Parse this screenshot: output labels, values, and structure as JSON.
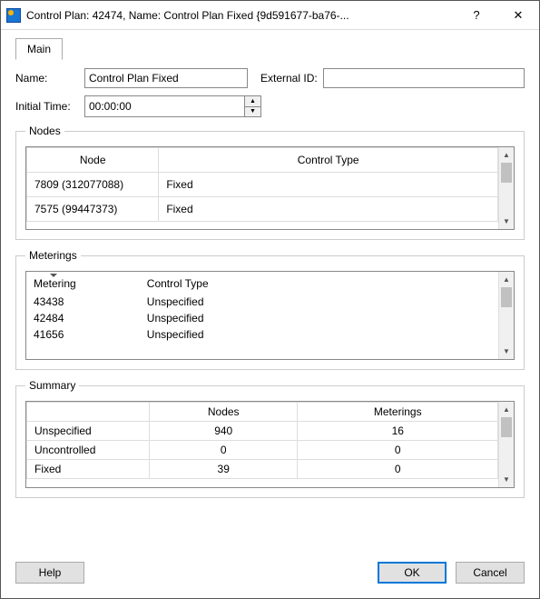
{
  "window": {
    "title": "Control Plan: 42474, Name: Control Plan Fixed  {9d591677-ba76-...",
    "help_glyph": "?",
    "close_glyph": "✕"
  },
  "tabs": {
    "main": "Main"
  },
  "fields": {
    "name_label": "Name:",
    "name_value": "Control Plan Fixed",
    "ext_label": "External ID:",
    "ext_value": "",
    "time_label": "Initial Time:",
    "time_value": "00:00:00"
  },
  "nodes": {
    "legend": "Nodes",
    "col_node": "Node",
    "col_type": "Control Type",
    "rows": [
      {
        "id": "7809 (312077088)",
        "type": "Fixed"
      },
      {
        "id": "7575 (99447373)",
        "type": "Fixed"
      }
    ]
  },
  "meterings": {
    "legend": "Meterings",
    "col_met": "Metering",
    "col_type": "Control Type",
    "rows": [
      {
        "id": "43438",
        "type": "Unspecified"
      },
      {
        "id": "42484",
        "type": "Unspecified"
      },
      {
        "id": "41656",
        "type": "Unspecified"
      }
    ]
  },
  "summary": {
    "legend": "Summary",
    "col_nodes": "Nodes",
    "col_met": "Meterings",
    "rows": [
      {
        "label": "Unspecified",
        "nodes": "940",
        "meterings": "16"
      },
      {
        "label": "Uncontrolled",
        "nodes": "0",
        "meterings": "0"
      },
      {
        "label": "Fixed",
        "nodes": "39",
        "meterings": "0"
      }
    ]
  },
  "footer": {
    "help": "Help",
    "ok": "OK",
    "cancel": "Cancel"
  }
}
